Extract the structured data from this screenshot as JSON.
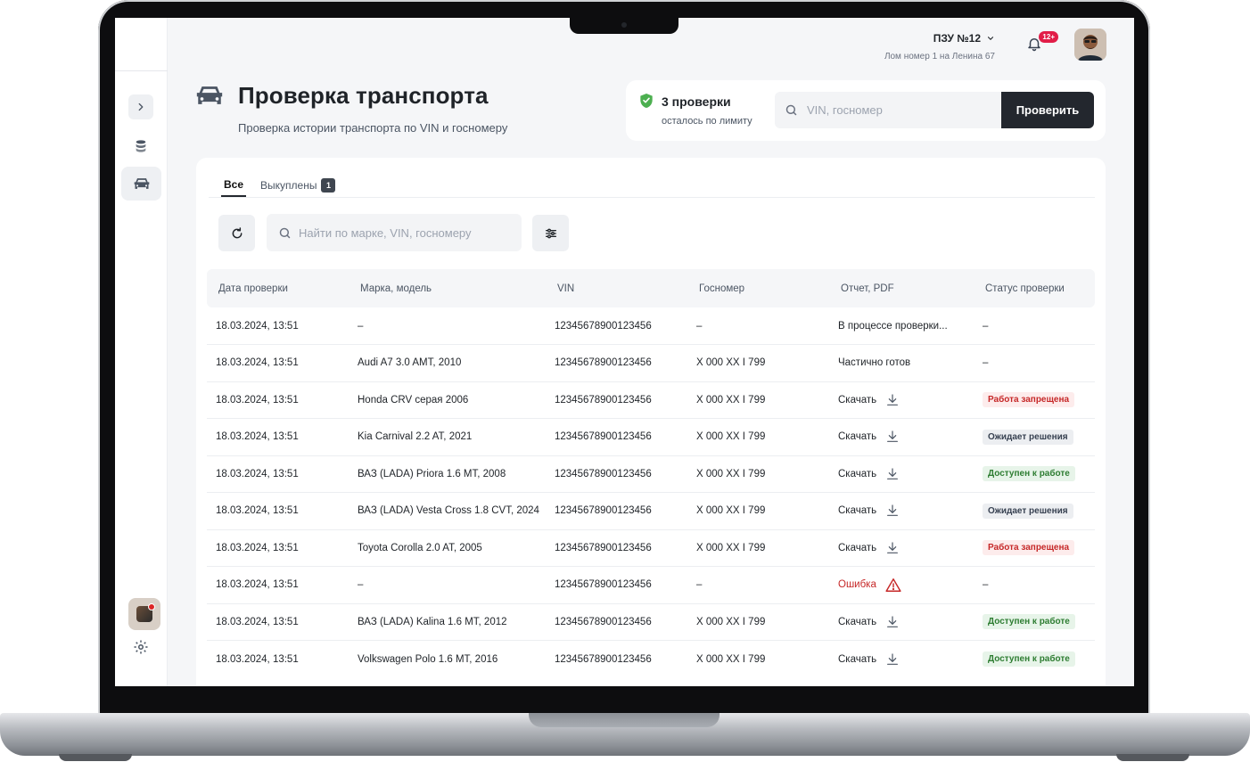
{
  "header": {
    "org_name": "ПЗУ №12",
    "org_address": "Лом номер 1 на Ленина 67",
    "notifications_count": "12+"
  },
  "page": {
    "title": "Проверка транспорта",
    "subtitle": "Проверка истории транспорта по VIN и госномеру"
  },
  "limit": {
    "checks_left": "3 проверки",
    "checks_left_caption": "осталось по лимиту"
  },
  "vin_search": {
    "placeholder": "VIN, госномер",
    "button_label": "Проверить"
  },
  "tabs": [
    {
      "label": "Все",
      "active": true
    },
    {
      "label": "Выкуплены",
      "badge": "1"
    }
  ],
  "toolbar": {
    "search_placeholder": "Найти по марке, VIN, госномеру"
  },
  "table": {
    "columns": [
      "Дата проверки",
      "Марка, модель",
      "VIN",
      "Госномер",
      "Отчет, PDF",
      "Статус проверки"
    ],
    "rows": [
      {
        "date": "18.03.2024,  13:51",
        "model": "–",
        "vin": "12345678900123456",
        "plate": "–",
        "report": "В процессе проверки...",
        "report_kind": "text",
        "status": "–",
        "status_kind": "none"
      },
      {
        "date": "18.03.2024,  13:51",
        "model": "Audi A7 3.0 AMT, 2010",
        "vin": "12345678900123456",
        "plate": "X 000 XX I 799",
        "report": "Частично готов",
        "report_kind": "text",
        "status": "–",
        "status_kind": "none"
      },
      {
        "date": "18.03.2024,  13:51",
        "model": "Honda CRV серая 2006",
        "vin": "12345678900123456",
        "plate": "X 000 XX I 799",
        "report": "Скачать",
        "report_kind": "download",
        "status": "Работа запрещена",
        "status_kind": "red"
      },
      {
        "date": "18.03.2024,  13:51",
        "model": "Kia Carnival 2.2 AT, 2021",
        "vin": "12345678900123456",
        "plate": "X 000 XX I 799",
        "report": "Скачать",
        "report_kind": "download",
        "status": "Ожидает решения",
        "status_kind": "gray"
      },
      {
        "date": "18.03.2024,  13:51",
        "model": "ВАЗ (LADA) Priora 1.6 MT, 2008",
        "vin": "12345678900123456",
        "plate": "X 000 XX I 799",
        "report": "Скачать",
        "report_kind": "download",
        "status": "Доступен к работе",
        "status_kind": "green"
      },
      {
        "date": "18.03.2024,  13:51",
        "model": "ВАЗ (LADA) Vesta Cross 1.8 CVT, 2024",
        "vin": "12345678900123456",
        "plate": "X 000 XX I 799",
        "report": "Скачать",
        "report_kind": "download",
        "status": "Ожидает решения",
        "status_kind": "gray"
      },
      {
        "date": "18.03.2024,  13:51",
        "model": "Toyota Corolla 2.0 AT, 2005",
        "vin": "12345678900123456",
        "plate": "X 000 XX I 799",
        "report": "Скачать",
        "report_kind": "download",
        "status": "Работа запрещена",
        "status_kind": "red"
      },
      {
        "date": "18.03.2024,  13:51",
        "model": "–",
        "vin": "12345678900123456",
        "plate": "–",
        "report": "Ошибка",
        "report_kind": "error",
        "status": "–",
        "status_kind": "none"
      },
      {
        "date": "18.03.2024,  13:51",
        "model": "ВАЗ (LADA) Kalina 1.6 MT, 2012",
        "vin": "12345678900123456",
        "plate": "X 000 XX I 799",
        "report": "Скачать",
        "report_kind": "download",
        "status": "Доступен к работе",
        "status_kind": "green"
      },
      {
        "date": "18.03.2024,  13:51",
        "model": "Volkswagen Polo 1.6 MT, 2016",
        "vin": "12345678900123456",
        "plate": "X 000 XX I 799",
        "report": "Скачать",
        "report_kind": "download",
        "status": "Доступен к работе",
        "status_kind": "green"
      }
    ]
  },
  "icons": {
    "download": "download-icon",
    "error": "warning-triangle-icon",
    "limit": "shield-check-icon"
  },
  "colors": {
    "primary_button": "#23272e",
    "status_red": "#c62828",
    "status_green": "#2e7d32",
    "notification_badge": "#e11d48"
  }
}
